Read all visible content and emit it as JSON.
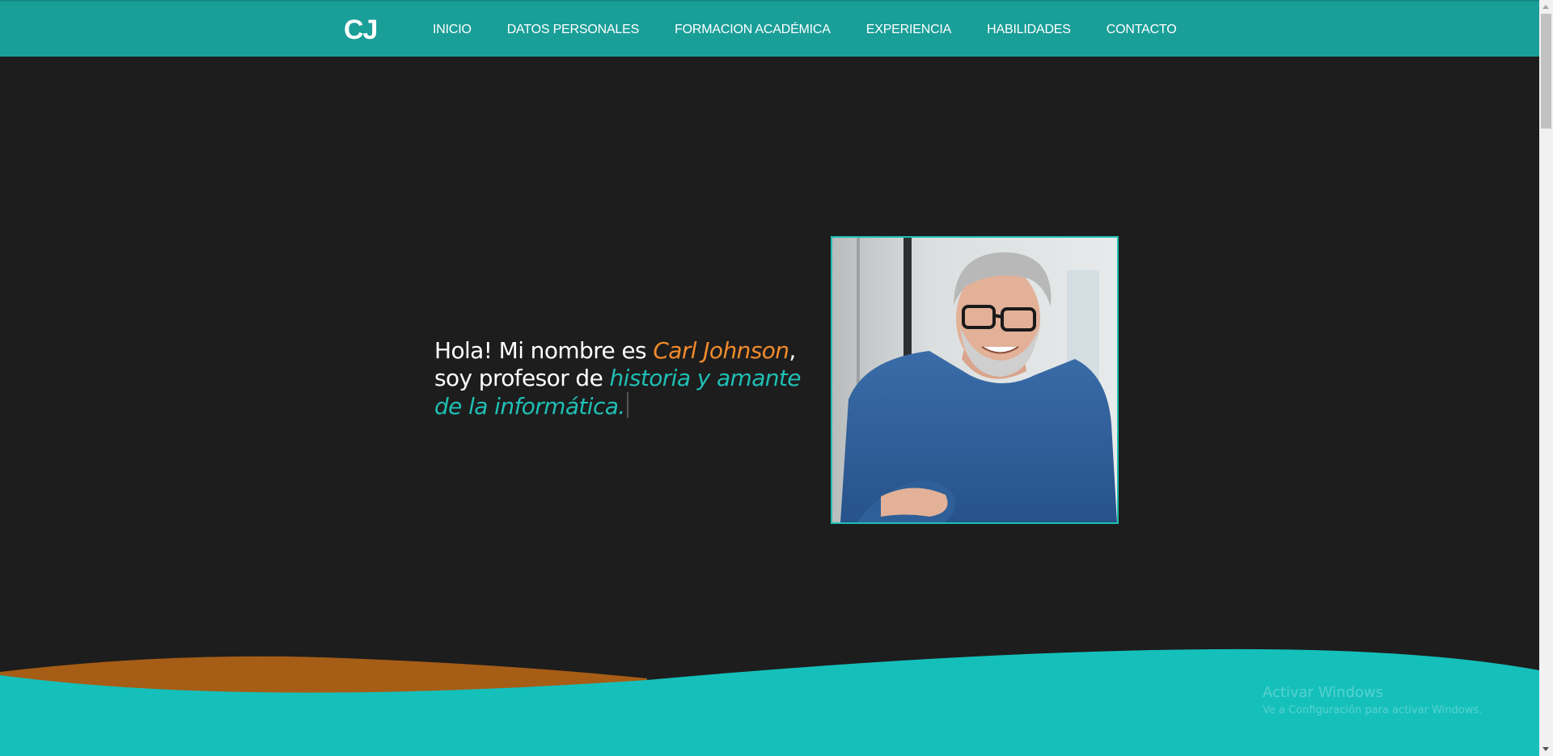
{
  "nav": {
    "logo": "CJ",
    "links": [
      "INICIO",
      "DATOS PERSONALES",
      "FORMACION ACADÉMICA",
      "EXPERIENCIA",
      "HABILIDADES",
      "CONTACTO"
    ]
  },
  "hero": {
    "intro": "Hola! Mi nombre es ",
    "name": "Carl Johnson",
    "comma": ",",
    "middle": " soy profesor de ",
    "role": "historia y amante de la informática."
  },
  "watermark": {
    "title": "Activar Windows",
    "subtitle": "Ve a Configuración para activar Windows."
  },
  "colors": {
    "nav_bg": "#1a9e98",
    "page_bg": "#1d1d1d",
    "accent_orange": "#f28b2c",
    "accent_teal": "#1fbfb4",
    "wave_teal": "#15c0bb",
    "wave_brown": "#a65d16"
  },
  "photo": {
    "subject": "smiling grey-haired man with glasses wearing a blue sweater"
  }
}
